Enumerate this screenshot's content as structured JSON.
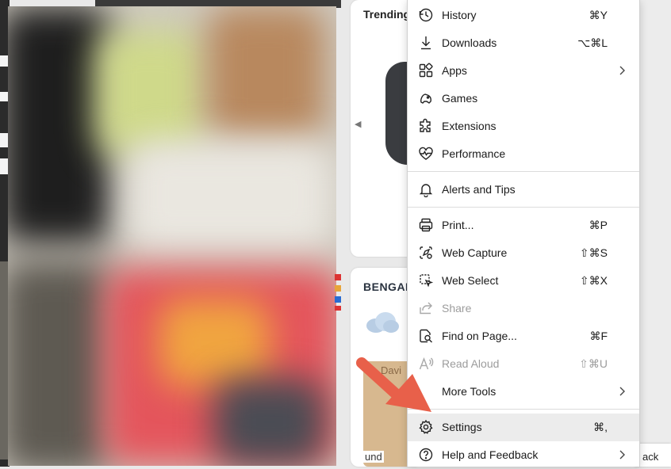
{
  "background": {
    "trending_label": "Trending",
    "weather_label": "BENGAL",
    "map_text_1": "Davi",
    "map_text_2": "und",
    "feedback_peek_text": "ack"
  },
  "menu": {
    "items": [
      {
        "label": "History",
        "shortcut": "⌘Y",
        "icon": "history-icon"
      },
      {
        "label": "Downloads",
        "shortcut": "⌥⌘L",
        "icon": "download-icon"
      },
      {
        "label": "Apps",
        "shortcut": "",
        "icon": "apps-icon",
        "submenu": true
      },
      {
        "label": "Games",
        "shortcut": "",
        "icon": "games-icon"
      },
      {
        "label": "Extensions",
        "shortcut": "",
        "icon": "extensions-icon"
      },
      {
        "label": "Performance",
        "shortcut": "",
        "icon": "performance-icon"
      },
      {
        "label": "Alerts and Tips",
        "shortcut": "",
        "icon": "bell-icon"
      },
      {
        "label": "Print...",
        "shortcut": "⌘P",
        "icon": "printer-icon"
      },
      {
        "label": "Web Capture",
        "shortcut": "⇧⌘S",
        "icon": "web-capture-icon"
      },
      {
        "label": "Web Select",
        "shortcut": "⇧⌘X",
        "icon": "web-select-icon"
      },
      {
        "label": "Share",
        "shortcut": "",
        "icon": "share-icon",
        "disabled": true
      },
      {
        "label": "Find on Page...",
        "shortcut": "⌘F",
        "icon": "find-icon"
      },
      {
        "label": "Read Aloud",
        "shortcut": "⇧⌘U",
        "icon": "read-aloud-icon",
        "disabled": true
      },
      {
        "label": "More Tools",
        "shortcut": "",
        "icon": "more-tools-icon",
        "submenu": true
      },
      {
        "label": "Settings",
        "shortcut": "⌘,",
        "icon": "gear-icon",
        "highlighted": true
      },
      {
        "label": "Help and Feedback",
        "shortcut": "",
        "icon": "help-icon",
        "submenu": true
      }
    ]
  },
  "annotation": {
    "color": "#e8604a",
    "icon": "red-arrow-pointer"
  }
}
